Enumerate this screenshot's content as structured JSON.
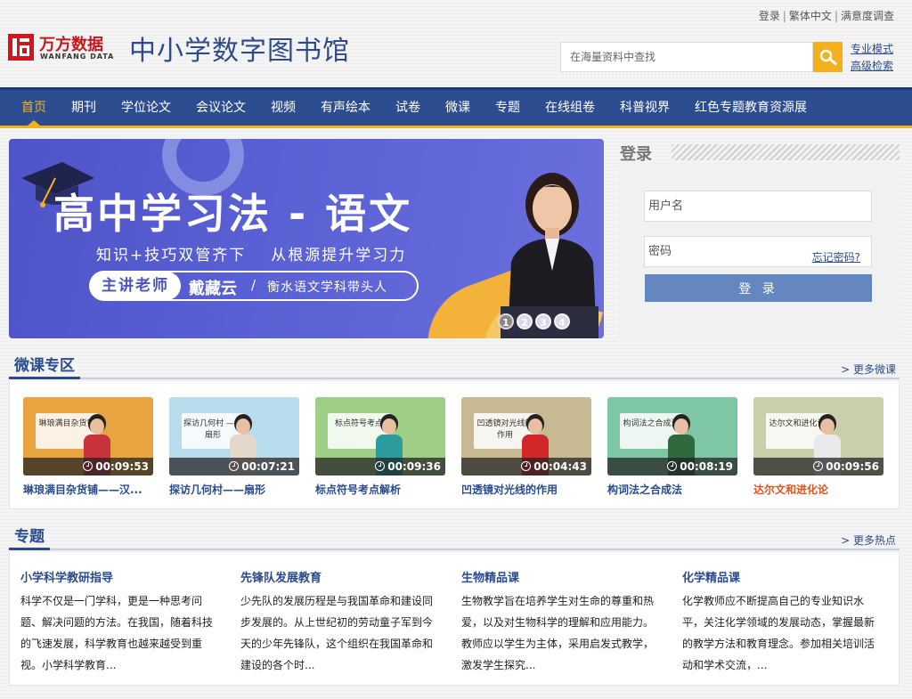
{
  "top_links": [
    "登录",
    "繁体中文",
    "满意度调查"
  ],
  "logo": {
    "cn": "万方数据",
    "en": "WANFANG DATA"
  },
  "site_title": "中小学数字图书馆",
  "search": {
    "placeholder": "在海量资料中查找"
  },
  "search_modes": [
    "专业模式",
    "高级检索"
  ],
  "nav": [
    "首页",
    "期刊",
    "学位论文",
    "会议论文",
    "视频",
    "有声绘本",
    "试卷",
    "微课",
    "专题",
    "在线组卷",
    "科普视界",
    "红色专题教育资源展"
  ],
  "banner": {
    "title": "高中学习法 - 语文",
    "subtitle1": "知识+技巧双管齐下",
    "subtitle2": "从根源提升学习力",
    "label": "主讲老师",
    "teacher": "戴藏云",
    "slash": "/",
    "role": "衡水语文学科带头人",
    "dots": [
      "1",
      "2",
      "3",
      "4"
    ],
    "active_dot": 0
  },
  "login": {
    "title": "登录",
    "username_placeholder": "用户名",
    "password_placeholder": "密码",
    "forgot": "忘记密码?",
    "button": "登 录"
  },
  "micro": {
    "title": "微课专区",
    "more": "> 更多微课",
    "videos": [
      {
        "title": "琳琅满目杂货铺——汉...",
        "duration": "00:09:53",
        "board": "琳琅满目杂货铺",
        "bg": "#e7a441",
        "shirt": "#c8323a"
      },
      {
        "title": "探访几何村——扇形",
        "duration": "00:07:21",
        "board": "探访几何村 ——扇形",
        "bg": "#b9dcec",
        "shirt": "#e4d8cc"
      },
      {
        "title": "标点符号考点解析",
        "duration": "00:09:36",
        "board": "标点符号考点",
        "bg": "#9fcf86",
        "shirt": "#2d9b9b"
      },
      {
        "title": "凹透镜对光线的作用",
        "duration": "00:04:43",
        "board": "凹透镜对光线的作用",
        "bg": "#c7ba93",
        "shirt": "#d2262b"
      },
      {
        "title": "构词法之合成法",
        "duration": "00:08:19",
        "board": "构词法之合成法",
        "bg": "#7fc7a4",
        "shirt": "#2f6a3e"
      },
      {
        "title": "达尔文和进化论",
        "duration": "00:09:56",
        "board": "达尔文和进化论",
        "bg": "#c9d0a9",
        "shirt": "#e9e9e9",
        "hot": true
      }
    ]
  },
  "topics": {
    "title": "专题",
    "more": "> 更多热点",
    "items": [
      {
        "title": "小学科学教研指导",
        "text": "科学不仅是一门学科，更是一种思考问题、解决问题的方法。在我国，随着科技的飞速发展，科学教育也越来越受到重视。小学科学教育..."
      },
      {
        "title": "先锋队发展教育",
        "text": "少先队的发展历程是与我国革命和建设同步发展的。从上世纪初的劳动童子军到今天的少年先锋队，这个组织在我国革命和建设的各个时..."
      },
      {
        "title": "生物精品课",
        "text": "生物教学旨在培养学生对生命的尊重和热爱，以及对生物科学的理解和应用能力。教师应以学生为主体，采用启发式教学，激发学生探究..."
      },
      {
        "title": "化学精品课",
        "text": "化学教师应不断提高自己的专业知识水平，关注化学领域的发展动态，掌握最新的教学方法和教育理念。参加相关培训活动和学术交流，..."
      }
    ]
  }
}
